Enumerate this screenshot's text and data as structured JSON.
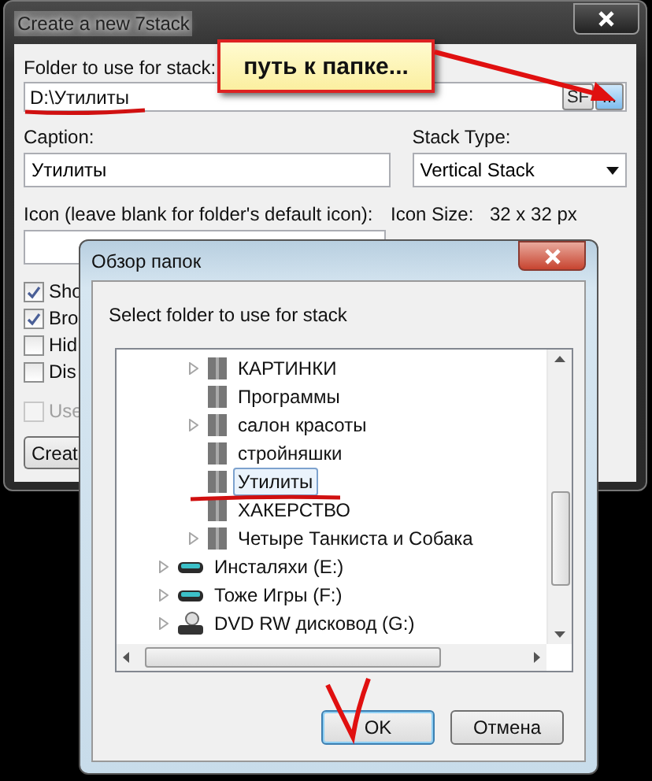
{
  "main_window": {
    "title": "Create a new 7stack",
    "folder_label": "Folder to use for stack:",
    "folder_value": "D:\\Утилиты",
    "sf_button": "SF",
    "browse_button": "...",
    "caption_label": "Caption:",
    "caption_value": "Утилиты",
    "stack_type_label": "Stack Type:",
    "stack_type_value": "Vertical Stack",
    "icon_label": "Icon (leave blank for folder's default icon):",
    "icon_size_label": "Icon Size:",
    "icon_size_value": "32 x 32 px",
    "checkboxes": [
      {
        "label": "Sho",
        "checked": true,
        "disabled": false
      },
      {
        "label": "Bro",
        "checked": true,
        "disabled": false
      },
      {
        "label": "Hid",
        "checked": false,
        "disabled": false
      },
      {
        "label": "Dis",
        "checked": false,
        "disabled": false
      },
      {
        "label": "Use",
        "checked": false,
        "disabled": true
      }
    ],
    "create_button": "Creat"
  },
  "browse_dialog": {
    "title": "Обзор папок",
    "prompt": "Select folder to use for stack",
    "nested_items": [
      {
        "label": "КАРТИНКИ",
        "expandable": true,
        "selected": false
      },
      {
        "label": "Программы",
        "expandable": false,
        "selected": false
      },
      {
        "label": "салон красоты",
        "expandable": true,
        "selected": false
      },
      {
        "label": "стройняшки",
        "expandable": false,
        "selected": false
      },
      {
        "label": "Утилиты",
        "expandable": false,
        "selected": true
      },
      {
        "label": "ХАКЕРСТВО",
        "expandable": false,
        "selected": false
      },
      {
        "label": "Четыре Танкиста и Собака",
        "expandable": true,
        "selected": false
      }
    ],
    "items": [
      {
        "label": "Инсталяхи (E:)",
        "kind": "drive",
        "expandable": true
      },
      {
        "label": "Тоже Игры (F:)",
        "kind": "drive",
        "expandable": true
      },
      {
        "label": "DVD RW дисковод (G:)",
        "kind": "dvd",
        "expandable": true
      }
    ],
    "buttons": [
      {
        "label": "OK",
        "default": true
      },
      {
        "label": "Отмена",
        "default": false
      }
    ]
  },
  "annotation": {
    "callout": "путь к папке..."
  }
}
